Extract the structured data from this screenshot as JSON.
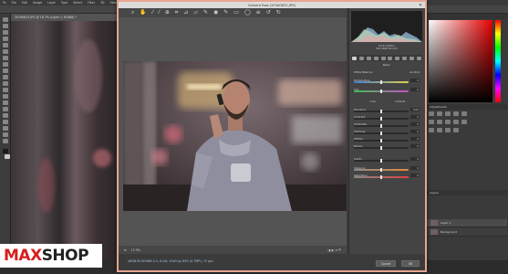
{
  "photoshop": {
    "menu": [
      "Ps",
      "File",
      "Edit",
      "Image",
      "Layer",
      "Type",
      "Select",
      "Filter",
      "3D",
      "View",
      "Window",
      "Help"
    ],
    "doc_tab": "20190625.JPG @ 16.7% (Layer 1, RGB/8) *",
    "panels": {
      "adjustments": "Adjustments",
      "layers": "Layers",
      "layer_names": [
        "Layer 1",
        "Background"
      ]
    }
  },
  "camera_raw": {
    "title": "Camera Raw (2F3A0622.JPG)",
    "section": "Basic",
    "white_balance_label": "White Balance:",
    "white_balance_value": "As Shot",
    "readout": [
      "f/2.8  1/200 s",
      "ISO 1600  50 mm"
    ],
    "sliders": [
      {
        "label": "Temperature",
        "value": "0",
        "level": 0.5
      },
      {
        "label": "Tint",
        "value": "0",
        "level": 0.5
      },
      {
        "label": "Exposure",
        "value": "0.00",
        "level": 0.5
      },
      {
        "label": "Contrast",
        "value": "0",
        "level": 0.5
      },
      {
        "label": "Highlights",
        "value": "0",
        "level": 0.5
      },
      {
        "label": "Shadows",
        "value": "0",
        "level": 0.5
      },
      {
        "label": "Whites",
        "value": "0",
        "level": 0.5
      },
      {
        "label": "Blacks",
        "value": "0",
        "level": 0.5
      },
      {
        "label": "Clarity",
        "value": "0",
        "level": 0.5
      },
      {
        "label": "Vibrance",
        "value": "0",
        "level": 0.5
      },
      {
        "label": "Saturation",
        "value": "0",
        "level": 0.5
      }
    ],
    "auto_label": "Auto",
    "default_label": "Default",
    "zoom": "17.5%",
    "workflow": "sRGB IEC61966-2.1; 8 bit; 1040 by 693 (0.7MP); 72 ppi",
    "buttons": {
      "cancel": "Cancel",
      "ok": "OK"
    }
  },
  "watermark": {
    "brand": "MAXSHOP"
  }
}
